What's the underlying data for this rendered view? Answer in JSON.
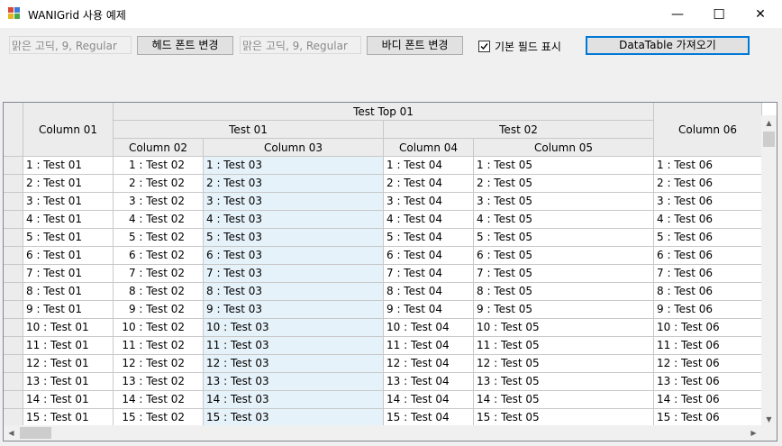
{
  "window": {
    "title": "WANIGrid 사용 예제",
    "minimize": "—",
    "maximize": "☐",
    "close": "✕"
  },
  "toolbar": {
    "head_font_value": "맑은 고딕, 9, Regular",
    "head_font_button": "헤드 폰트 변경",
    "body_font_value": "맑은 고딕, 9, Regular",
    "body_font_button": "바디 폰트 변경",
    "basic_field_label": "기본 필드 표시",
    "basic_field_checked": true,
    "datatable_button": "DataTable 가져오기"
  },
  "grid": {
    "top_group": "Test Top 01",
    "group_test01": "Test 01",
    "group_test02": "Test 02",
    "columns": [
      "Column 01",
      "Column 02",
      "Column 03",
      "Column 04",
      "Column 05",
      "Column 06"
    ],
    "rows": [
      [
        "1 : Test 01",
        "1 : Test 02",
        "1 : Test 03",
        "1 : Test 04",
        "1 : Test 05",
        "1 : Test 06"
      ],
      [
        "2 : Test 01",
        "2 : Test 02",
        "2 : Test 03",
        "2 : Test 04",
        "2 : Test 05",
        "2 : Test 06"
      ],
      [
        "3 : Test 01",
        "3 : Test 02",
        "3 : Test 03",
        "3 : Test 04",
        "3 : Test 05",
        "3 : Test 06"
      ],
      [
        "4 : Test 01",
        "4 : Test 02",
        "4 : Test 03",
        "4 : Test 04",
        "4 : Test 05",
        "4 : Test 06"
      ],
      [
        "5 : Test 01",
        "5 : Test 02",
        "5 : Test 03",
        "5 : Test 04",
        "5 : Test 05",
        "5 : Test 06"
      ],
      [
        "6 : Test 01",
        "6 : Test 02",
        "6 : Test 03",
        "6 : Test 04",
        "6 : Test 05",
        "6 : Test 06"
      ],
      [
        "7 : Test 01",
        "7 : Test 02",
        "7 : Test 03",
        "7 : Test 04",
        "7 : Test 05",
        "7 : Test 06"
      ],
      [
        "8 : Test 01",
        "8 : Test 02",
        "8 : Test 03",
        "8 : Test 04",
        "8 : Test 05",
        "8 : Test 06"
      ],
      [
        "9 : Test 01",
        "9 : Test 02",
        "9 : Test 03",
        "9 : Test 04",
        "9 : Test 05",
        "9 : Test 06"
      ],
      [
        "10 : Test 01",
        "10 : Test 02",
        "10 : Test 03",
        "10 : Test 04",
        "10 : Test 05",
        "10 : Test 06"
      ],
      [
        "11 : Test 01",
        "11 : Test 02",
        "11 : Test 03",
        "11 : Test 04",
        "11 : Test 05",
        "11 : Test 06"
      ],
      [
        "12 : Test 01",
        "12 : Test 02",
        "12 : Test 03",
        "12 : Test 04",
        "12 : Test 05",
        "12 : Test 06"
      ],
      [
        "13 : Test 01",
        "13 : Test 02",
        "13 : Test 03",
        "13 : Test 04",
        "13 : Test 05",
        "13 : Test 06"
      ],
      [
        "14 : Test 01",
        "14 : Test 02",
        "14 : Test 03",
        "14 : Test 04",
        "14 : Test 05",
        "14 : Test 06"
      ],
      [
        "15 : Test 01",
        "15 : Test 02",
        "15 : Test 03",
        "15 : Test 04",
        "15 : Test 05",
        "15 : Test 06"
      ]
    ]
  },
  "colors": {
    "accent": "#0078d7",
    "selected_column": "#e6f2fa"
  }
}
